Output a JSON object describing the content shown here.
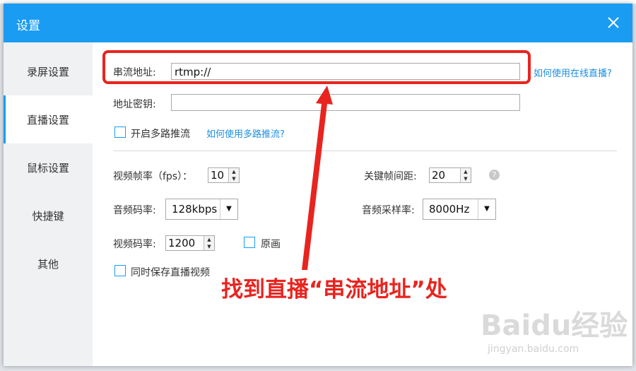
{
  "window": {
    "title": "设置"
  },
  "sidebar": {
    "items": [
      {
        "label": "录屏设置"
      },
      {
        "label": "直播设置"
      },
      {
        "label": "鼠标设置"
      },
      {
        "label": "快捷键"
      },
      {
        "label": "其他"
      }
    ],
    "active": "直播设置"
  },
  "stream": {
    "url_label": "串流地址:",
    "url_value": "rtmp://",
    "url_help_link": "如何使用在线直播?",
    "key_label": "地址密钥:",
    "key_value": "",
    "multi_label": "开启多路推流",
    "multi_checked": false,
    "multi_help_link": "如何使用多路推流?"
  },
  "params": {
    "fps_label": "视频帧率（fps）：",
    "fps_value": "10",
    "keyframe_label": "关键帧间距:",
    "keyframe_value": "20",
    "help_glyph": "?",
    "audio_bitrate_label": "音频码率:",
    "audio_bitrate_value": "128kbps",
    "audio_sample_label": "音频采样率:",
    "audio_sample_value": "8000Hz",
    "video_bitrate_label": "视频码率:",
    "video_bitrate_value": "1200",
    "original_label": "原画",
    "original_checked": false,
    "save_live_label": "同时保存直播视频",
    "save_live_checked": false
  },
  "annotation": {
    "text": "找到直播“串流地址”处",
    "color": "#e8241f"
  },
  "watermark": {
    "brand": "Baidu经验",
    "url": "jingyan.baidu.com"
  },
  "colors": {
    "accent": "#1a9cf2",
    "sidebar_bg": "#f0f1f3",
    "link": "#1a8fe0"
  }
}
